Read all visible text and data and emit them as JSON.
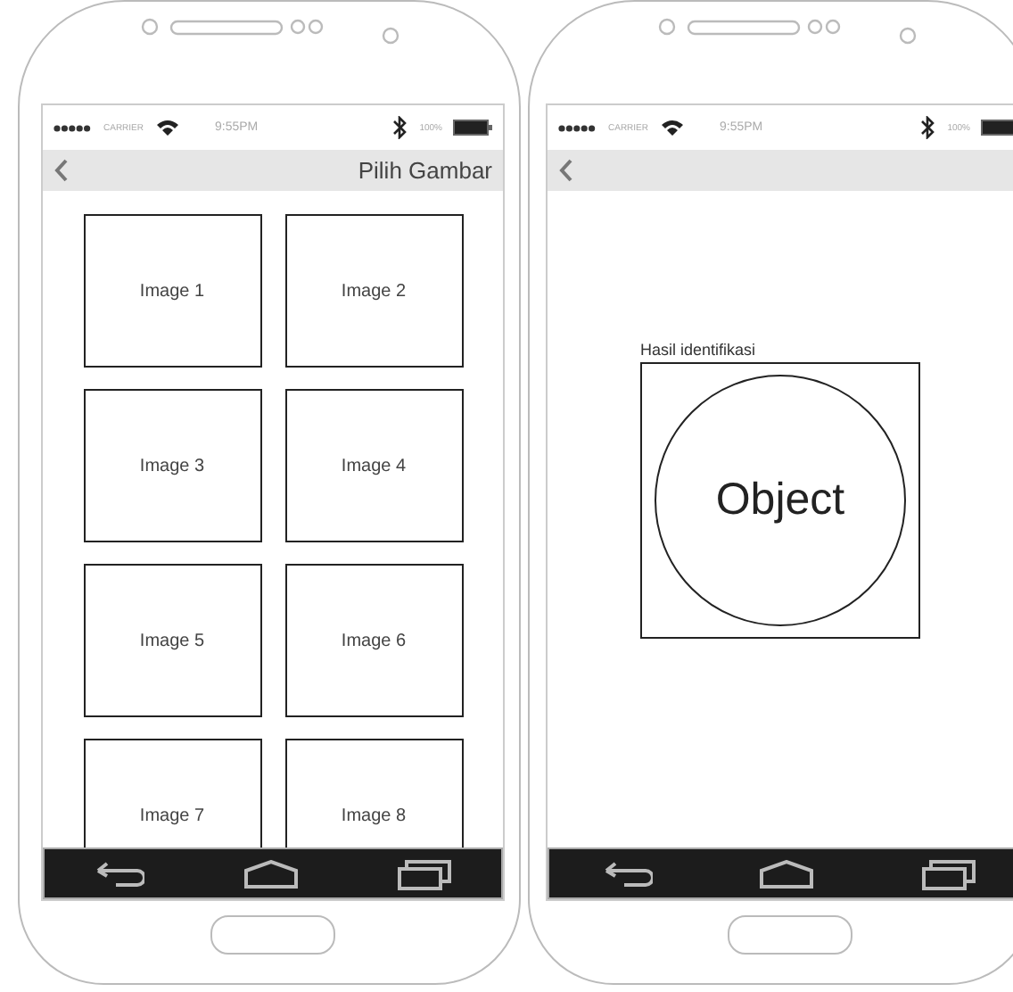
{
  "phones": [
    {
      "status_bar": {
        "carrier": "CARRIER",
        "time": "9:55PM",
        "battery": "100%"
      },
      "header": {
        "title": "Pilih Gambar"
      },
      "screen": {
        "kind": "grid",
        "images": [
          "Image 1",
          "Image 2",
          "Image 3",
          "Image 4",
          "Image 5",
          "Image 6",
          "Image 7",
          "Image 8"
        ]
      }
    },
    {
      "status_bar": {
        "carrier": "CARRIER",
        "time": "9:55PM",
        "battery": "100%"
      },
      "screen": {
        "kind": "result",
        "label": "Hasil identifikasi",
        "object": "Object"
      }
    }
  ]
}
